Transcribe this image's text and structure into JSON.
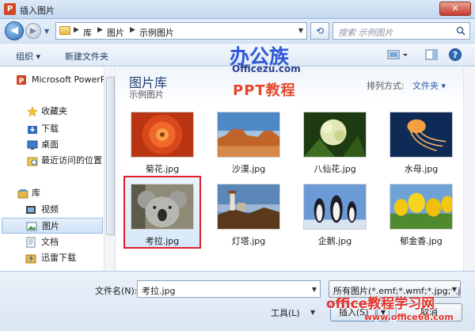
{
  "window": {
    "title": "插入图片",
    "app_icon_letter": "P",
    "close_glyph": "✕"
  },
  "address": {
    "breadcrumbs": [
      "库",
      "图片",
      "示例图片"
    ],
    "search_placeholder": "搜索 示例图片"
  },
  "toolbar": {
    "organize": "组织 ▾",
    "new_folder": "新建文件夹"
  },
  "nav": {
    "items": [
      {
        "label": "Microsoft PowerPoint",
        "icon": "powerpoint-icon"
      },
      {
        "label": "收藏夹",
        "icon": "star-icon"
      },
      {
        "label": "下载",
        "icon": "download-folder-icon"
      },
      {
        "label": "桌面",
        "icon": "desktop-icon"
      },
      {
        "label": "最近访问的位置",
        "icon": "recent-places-icon"
      },
      {
        "label": "库",
        "icon": "library-icon"
      },
      {
        "label": "视频",
        "icon": "video-icon"
      },
      {
        "label": "图片",
        "icon": "pictures-icon"
      },
      {
        "label": "文档",
        "icon": "documents-icon"
      },
      {
        "label": "迅雷下载",
        "icon": "thunder-download-icon"
      }
    ]
  },
  "library": {
    "title": "图片库",
    "subtitle": "示例图片",
    "arrange_label": "排列方式:",
    "arrange_value": "文件夹 ▾"
  },
  "files": [
    {
      "name": "菊花.jpg",
      "selected": false
    },
    {
      "name": "沙漠.jpg",
      "selected": false
    },
    {
      "name": "八仙花.jpg",
      "selected": false
    },
    {
      "name": "水母.jpg",
      "selected": false
    },
    {
      "name": "考拉.jpg",
      "selected": true
    },
    {
      "name": "灯塔.jpg",
      "selected": false
    },
    {
      "name": "企鹅.jpg",
      "selected": false
    },
    {
      "name": "郁金香.jpg",
      "selected": false
    }
  ],
  "bottom": {
    "filename_label": "文件名(N):",
    "filename_value": "考拉.jpg",
    "filter_value": "所有图片(*.emf;*.wmf;*.jpg;*.jp",
    "tools_label": "工具(L)",
    "insert_label": "插入(S)",
    "cancel_label": "取消"
  },
  "watermark": {
    "line1": "办公族",
    "line2": "Officezu.com",
    "line3": "PPT教程",
    "line4": "office教程学习网",
    "line5": "www.office68.com"
  },
  "colors": {
    "selection_border": "#e11d27",
    "library_title": "#1e3c70",
    "watermark_blue": "#2d57d8",
    "watermark_red": "#e3342a"
  }
}
